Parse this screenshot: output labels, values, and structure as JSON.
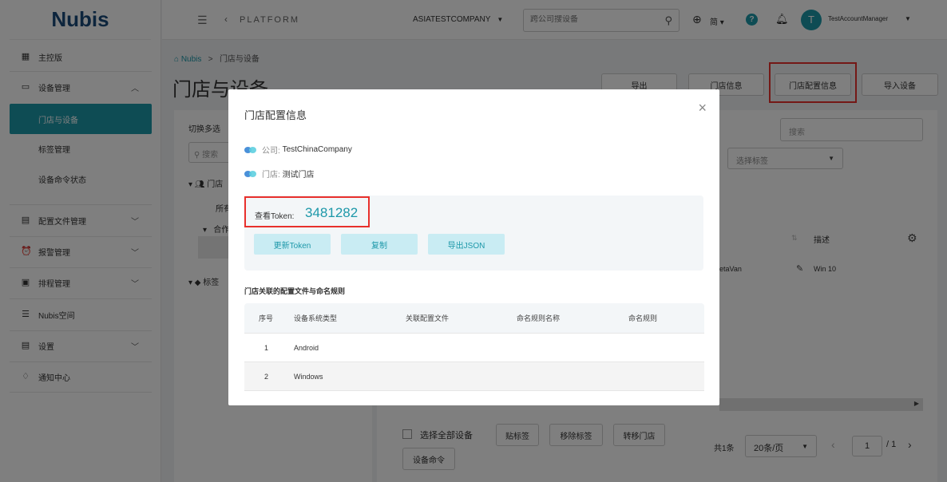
{
  "logo": {
    "text": "Nubis"
  },
  "sidebar": {
    "items": [
      {
        "label": "主控版",
        "icon": "dashboard-icon"
      },
      {
        "label": "设备管理",
        "icon": "devices-icon",
        "chevron": "⌃"
      },
      {
        "label": "门店与设备",
        "active": true
      },
      {
        "label": "标签管理"
      },
      {
        "label": "设备命令状态"
      },
      {
        "label": "配置文件管理",
        "icon": "config-file-icon",
        "chevron": "⌄"
      },
      {
        "label": "报警管理",
        "icon": "alarm-icon",
        "chevron": "⌄"
      },
      {
        "label": "排程管理",
        "icon": "calendar-icon",
        "chevron": "⌄"
      },
      {
        "label": "Nubis空间",
        "icon": "storage-icon"
      },
      {
        "label": "设置",
        "icon": "settings-doc-icon",
        "chevron": "⌄"
      },
      {
        "label": "通知中心",
        "icon": "notification-icon"
      }
    ]
  },
  "header": {
    "platform": "PLATFORM",
    "company": "ASIATESTCOMPANY",
    "search_placeholder": "跨公司搜设备",
    "lang": "简",
    "help": "?",
    "avatar_letter": "T",
    "user": "TestAccountManager"
  },
  "breadcrumb": {
    "home": "Nubis",
    "sep": ">",
    "current": "门店与设备"
  },
  "page_title": "门店与设备",
  "top_buttons": {
    "export": "导出",
    "store_info": "门店信息",
    "store_config": "门店配置信息",
    "import": "导入设备"
  },
  "left_panel": {
    "toggle_multi": "切换多选",
    "search_placeholder": "搜索",
    "tree": [
      "门店",
      "所有",
      "合作",
      "标签"
    ]
  },
  "right_panel": {
    "search_placeholder": "搜索",
    "tag_select": "选择标签",
    "col_desc": "描述",
    "row_value_1": "etaVan",
    "row_value_2": "Win 10"
  },
  "bottom": {
    "select_all": "选择全部设备",
    "tag_btn": "贴标签",
    "remove_tag_btn": "移除标签",
    "move_store_btn": "转移门店",
    "device_cmd_btn": "设备命令",
    "total": "共1条",
    "page_size": "20条/页",
    "page": "1",
    "page_total": "/ 1"
  },
  "modal": {
    "title": "门店配置信息",
    "company_key": "公司:",
    "company_value": "TestChinaCompany",
    "store_key": "门店:",
    "store_value": "测试门店",
    "token_label": "查看Token:",
    "token_value": "3481282",
    "btn_refresh": "更新Token",
    "btn_copy": "复制",
    "btn_export": "导出JSON",
    "section_title": "门店关联的配置文件与命名规则",
    "table": {
      "headers": [
        "序号",
        "设备系统类型",
        "关联配置文件",
        "命名规则名称",
        "命名规则"
      ],
      "rows": [
        [
          "1",
          "Android",
          "",
          "",
          ""
        ],
        [
          "2",
          "Windows",
          "",
          "",
          ""
        ]
      ]
    }
  },
  "colors": {
    "accent": "#1d98a9",
    "highlight": "#e8302c"
  }
}
